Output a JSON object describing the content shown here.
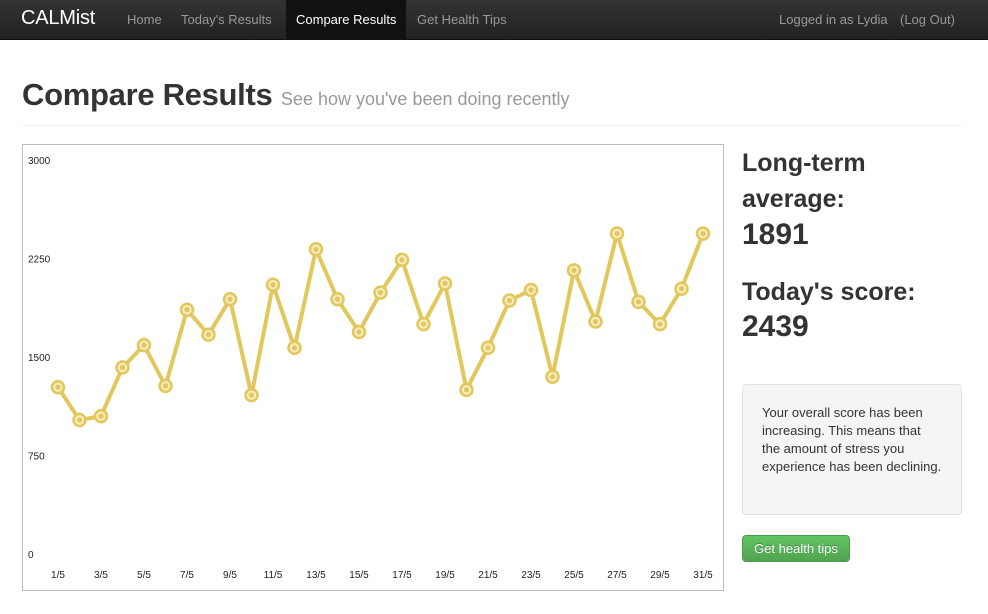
{
  "navbar": {
    "brand": "CALMist",
    "items": [
      {
        "label": "Home",
        "active": false
      },
      {
        "label": "Today's Results",
        "active": false
      },
      {
        "label": "Compare Results",
        "active": true
      },
      {
        "label": "Get Health Tips",
        "active": false
      }
    ],
    "user_text": "Logged in as Lydia",
    "logout_label": "(Log Out)"
  },
  "header": {
    "title": "Compare Results",
    "subtitle": "See how you've been doing recently"
  },
  "stats": {
    "long_term_label_line1": "Long-term",
    "long_term_label_line2": "average:",
    "long_term_value": "1891",
    "today_label": "Today's score:",
    "today_value": "2439"
  },
  "info": {
    "text": "Your overall score has been increasing. This means that the amount of stress you experience has been declining."
  },
  "button": {
    "tips_label": "Get health tips"
  },
  "colors": {
    "line": "#e2c75c",
    "button": "#5bb75b",
    "navbar": "#222222"
  },
  "chart_data": {
    "type": "line",
    "title": "",
    "xlabel": "",
    "ylabel": "",
    "ylim": [
      0,
      3000
    ],
    "yticks": [
      0,
      750,
      1500,
      2250,
      3000
    ],
    "xtick_labels": [
      "1/5",
      "3/5",
      "5/5",
      "7/5",
      "9/5",
      "11/5",
      "13/5",
      "15/5",
      "17/5",
      "19/5",
      "21/5",
      "23/5",
      "25/5",
      "27/5",
      "29/5",
      "31/5"
    ],
    "x": [
      "1/5",
      "2/5",
      "3/5",
      "4/5",
      "5/5",
      "6/5",
      "7/5",
      "8/5",
      "9/5",
      "10/5",
      "11/5",
      "12/5",
      "13/5",
      "14/5",
      "15/5",
      "16/5",
      "17/5",
      "18/5",
      "19/5",
      "20/5",
      "21/5",
      "22/5",
      "23/5",
      "24/5",
      "25/5",
      "26/5",
      "27/5",
      "28/5",
      "29/5",
      "30/5",
      "31/5"
    ],
    "series": [
      {
        "values": [
          1270,
          1020,
          1050,
          1420,
          1590,
          1280,
          1860,
          1670,
          1940,
          1210,
          2050,
          1570,
          2320,
          1940,
          1690,
          1990,
          2240,
          1750,
          2060,
          1250,
          1570,
          1930,
          2010,
          1350,
          2160,
          1770,
          2440,
          1920,
          1750,
          2020,
          2439
        ]
      }
    ],
    "grid": false,
    "legend": "none"
  }
}
